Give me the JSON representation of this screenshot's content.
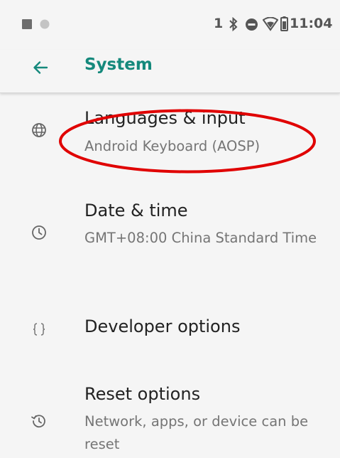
{
  "status_bar": {
    "time": "11:04",
    "sim_indicator": "1",
    "icons": [
      "image-notification-icon",
      "circle-notification-icon",
      "bluetooth-icon",
      "do-not-disturb-icon",
      "wifi-icon",
      "battery-icon"
    ]
  },
  "toolbar": {
    "title": "System",
    "back_icon": "back-arrow-icon"
  },
  "accent_color": "#15897c",
  "annotation_color": "#e00000",
  "items": [
    {
      "title": "Languages & input",
      "subtitle": "Android Keyboard (AOSP)",
      "icon": "globe-icon"
    },
    {
      "title": "Date & time",
      "subtitle": "GMT+08:00 China Standard Time",
      "icon": "clock-icon"
    },
    {
      "title": "Developer options",
      "subtitle": "",
      "icon": "braces-icon"
    },
    {
      "title": "Reset options",
      "subtitle": "Network, apps, or device can be reset",
      "icon": "reset-history-icon"
    }
  ]
}
